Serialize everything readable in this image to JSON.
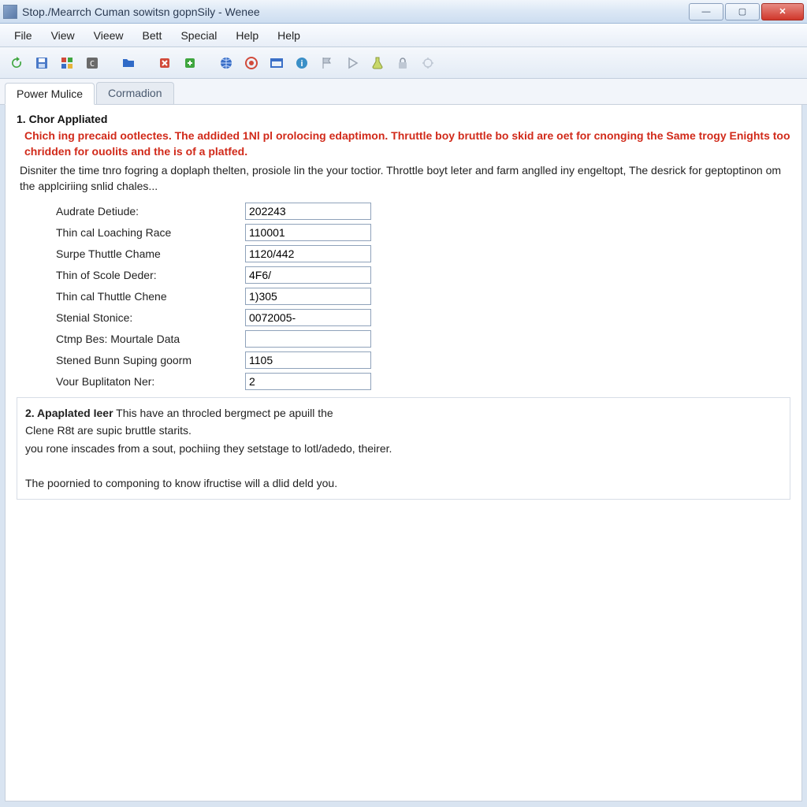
{
  "window": {
    "title": "Stop./Mearrch Cuman sowitsn gopnSily - Wenee"
  },
  "menu": {
    "file": "File",
    "view": "View",
    "vieew": "Vieew",
    "bett": "Bett",
    "special": "Special",
    "help": "Help",
    "help2": "Help"
  },
  "tabs": {
    "active": "Power Mulice",
    "inactive": "Cormadion"
  },
  "section1": {
    "heading": "1. Chor Appliated",
    "warn": "Chich ing precaid ootlectes. The addided 1Nl pl orolocing edaptimon. Thruttle boy bruttle bo skid are oet for cnonging the Same trogy Enights too chridden for ouolits and the is of a platfed.",
    "desc": "Disniter the time tnro fogring a doplaph thelten, prosiole lin the your toctior. Throttle boyt leter and farm anglled iny engeltopt, The desrick for geptoptinon om the applciriing snlid chales...",
    "fields": {
      "audrate": {
        "label": "Audrate Detiude:",
        "value": "202243"
      },
      "loaching": {
        "label": "Thin cal Loaching Race",
        "value": "110001"
      },
      "surpe": {
        "label": "Surpe Thuttle Chame",
        "value": "1120/442"
      },
      "scole": {
        "label": "Thin of Scole Deder:",
        "value": "4F6/"
      },
      "chene": {
        "label": "Thin cal Thuttle Chene",
        "value": "1)305"
      },
      "stonice": {
        "label": "Stenial Stonice:",
        "value": "0072005-"
      },
      "ctmp": {
        "label": "Ctmp Bes: Mourtale Data",
        "value": ""
      },
      "suping": {
        "label": "Stened Bunn Suping goorm",
        "value": "1105"
      },
      "vour": {
        "label": "Vour Buplitaton Ner:",
        "value": "2"
      }
    }
  },
  "section2": {
    "heading": "2. Apaplated Ieer",
    "line1": "This have an throcled bergmect pe apuill the",
    "line2": "Clene R8t are supic bruttle starits.",
    "line3": "you rone inscades from a sout, pochiing they setstage to lotl/adedo, theirer.",
    "line4": "The poornied to componing to know ifructise will a dlid deld you."
  }
}
